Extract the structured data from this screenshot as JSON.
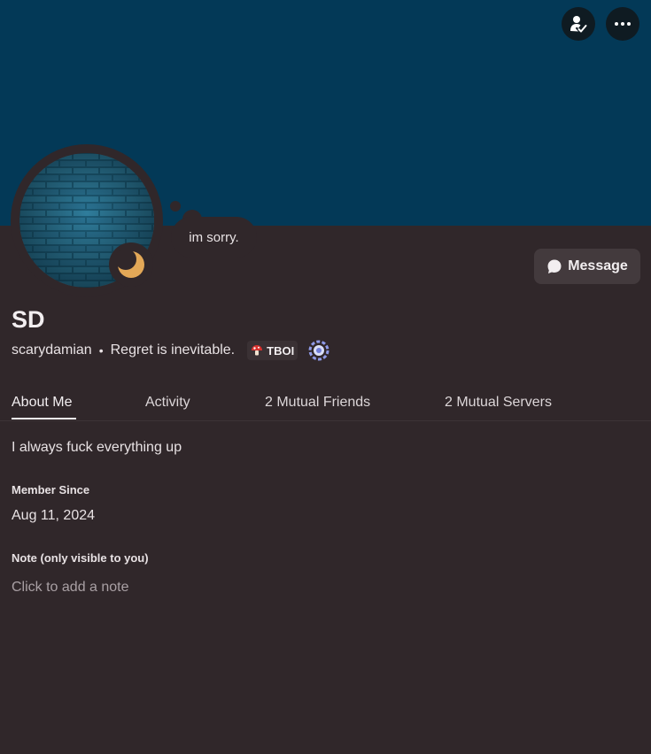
{
  "profile": {
    "display_name": "SD",
    "username": "scarydamian",
    "separator": "•",
    "pronouns_or_status": "Regret is inevitable.",
    "custom_status_bubble": "im sorry.",
    "guild_tag": "TBOI",
    "presence": "idle"
  },
  "actions": {
    "message_label": "Message"
  },
  "tabs": [
    {
      "label": "About Me",
      "active": true
    },
    {
      "label": "Activity",
      "active": false
    },
    {
      "label": "2 Mutual Friends",
      "active": false
    },
    {
      "label": "2 Mutual Servers",
      "active": false
    }
  ],
  "about": {
    "bio": "I always fuck everything up",
    "member_since_heading": "Member Since",
    "member_since_value": "Aug 11, 2024",
    "note_heading": "Note (only visible to you)",
    "note_placeholder": "Click to add a note"
  },
  "icons": {
    "friend_action": "person-check-icon",
    "more_action": "ellipsis-icon",
    "message": "chat-bubble-icon",
    "status": "moon-icon",
    "tag": "mushroom-icon",
    "badge": "quest-badge-icon"
  },
  "colors": {
    "banner": "#033957",
    "background": "#30272a",
    "idle_status": "#e3a857"
  }
}
